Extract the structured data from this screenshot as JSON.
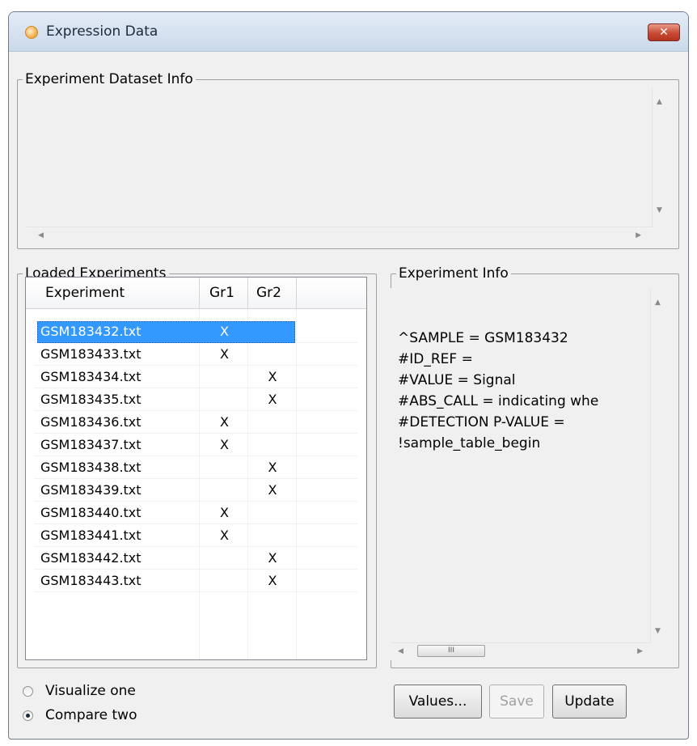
{
  "window": {
    "title": "Expression Data",
    "close_label": "✕"
  },
  "dataset_info": {
    "legend": "Experiment Dataset Info"
  },
  "loaded": {
    "legend": "Loaded Experiments",
    "columns": [
      "Experiment",
      "Gr1",
      "Gr2"
    ],
    "rows": [
      {
        "name": "GSM183432.txt",
        "gr1": "X",
        "gr2": "",
        "selected": true
      },
      {
        "name": "GSM183433.txt",
        "gr1": "X",
        "gr2": ""
      },
      {
        "name": "GSM183434.txt",
        "gr1": "",
        "gr2": "X"
      },
      {
        "name": "GSM183435.txt",
        "gr1": "",
        "gr2": "X"
      },
      {
        "name": "GSM183436.txt",
        "gr1": "X",
        "gr2": ""
      },
      {
        "name": "GSM183437.txt",
        "gr1": "X",
        "gr2": ""
      },
      {
        "name": "GSM183438.txt",
        "gr1": "",
        "gr2": "X"
      },
      {
        "name": "GSM183439.txt",
        "gr1": "",
        "gr2": "X"
      },
      {
        "name": "GSM183440.txt",
        "gr1": "X",
        "gr2": ""
      },
      {
        "name": "GSM183441.txt",
        "gr1": "X",
        "gr2": ""
      },
      {
        "name": "GSM183442.txt",
        "gr1": "",
        "gr2": "X"
      },
      {
        "name": "GSM183443.txt",
        "gr1": "",
        "gr2": "X"
      }
    ]
  },
  "experiment_info": {
    "legend": "Experiment Info",
    "lines": [
      "^SAMPLE = GSM183432",
      "#ID_REF =",
      "#VALUE = Signal",
      "#ABS_CALL = indicating whe",
      "#DETECTION P-VALUE =",
      "!sample_table_begin"
    ],
    "hscroll_thumb_label": "III"
  },
  "mode": {
    "options": [
      {
        "label": "Visualize one",
        "selected": false
      },
      {
        "label": "Compare two",
        "selected": true
      }
    ]
  },
  "buttons": {
    "values": "Values...",
    "save": "Save",
    "update": "Update"
  },
  "icons": {
    "app": "app-c-icon",
    "close": "close-icon"
  }
}
